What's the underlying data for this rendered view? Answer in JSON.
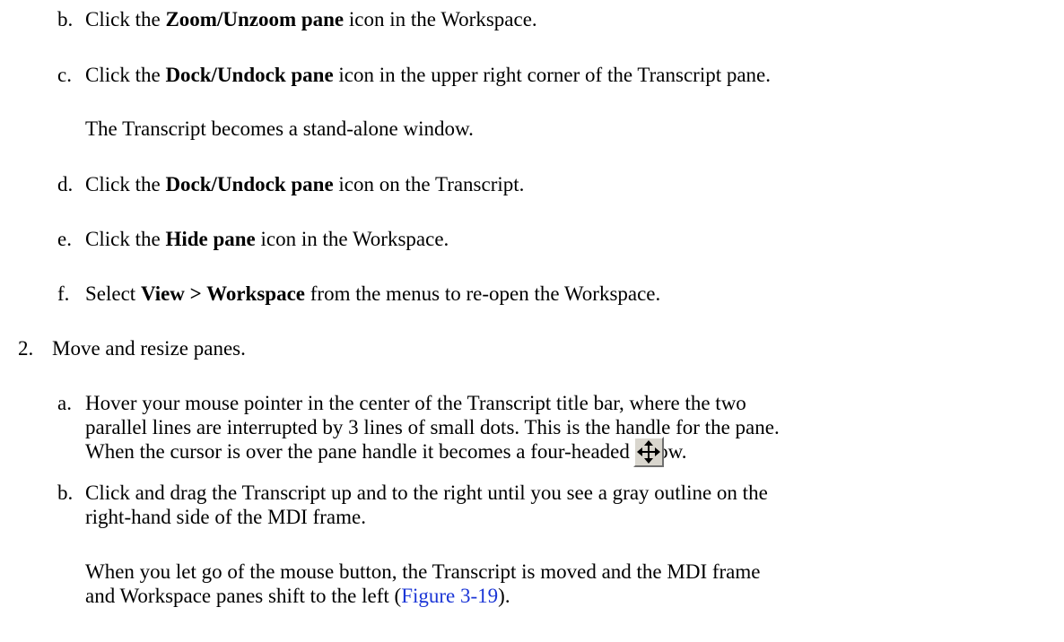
{
  "steps": {
    "b1": {
      "marker": "b.",
      "pre": "Click the ",
      "bold": "Zoom/Unzoom pane",
      "post": " icon in the Workspace."
    },
    "c1": {
      "marker": "c.",
      "pre": "Click the ",
      "bold": "Dock/Undock pane",
      "post": " icon in the upper right corner of the Transcript pane."
    },
    "c1_result": "The Transcript becomes a stand-alone window.",
    "d1": {
      "marker": "d.",
      "pre": "Click the ",
      "bold": "Dock/Undock pane",
      "post": " icon on the Transcript."
    },
    "e1": {
      "marker": "e.",
      "pre": "Click the ",
      "bold": "Hide pane",
      "post": " icon in the Workspace."
    },
    "f1": {
      "marker": "f.",
      "pre": "Select ",
      "bold": "View > Workspace",
      "post": " from the menus to re-open the Workspace."
    }
  },
  "step2": {
    "marker": "2.",
    "text": "Move and resize panes.",
    "a": {
      "marker": "a.",
      "line1": "Hover your mouse pointer in the center of the Transcript title bar, where the two",
      "line2": "parallel lines are interrupted by 3 lines of small dots. This is the handle for the pane.",
      "line3": "When the cursor is over the pane handle it becomes a four-headed arrow.",
      "icon": "four-headed-arrow-icon"
    },
    "b": {
      "marker": "b.",
      "line1": "Click and drag the Transcript up and to the right until you see a gray outline on the",
      "line2": "right-hand side of the MDI frame.",
      "result_line1": "When you let go of the mouse button, the Transcript is moved and the MDI frame",
      "result_line2_pre": "and Workspace panes shift to the left (",
      "result_line2_link": "Figure 3-19",
      "result_line2_post": ")."
    }
  },
  "colors": {
    "text": "#000000",
    "link": "#1a35d6",
    "icon_bg": "#d9d6ce"
  }
}
